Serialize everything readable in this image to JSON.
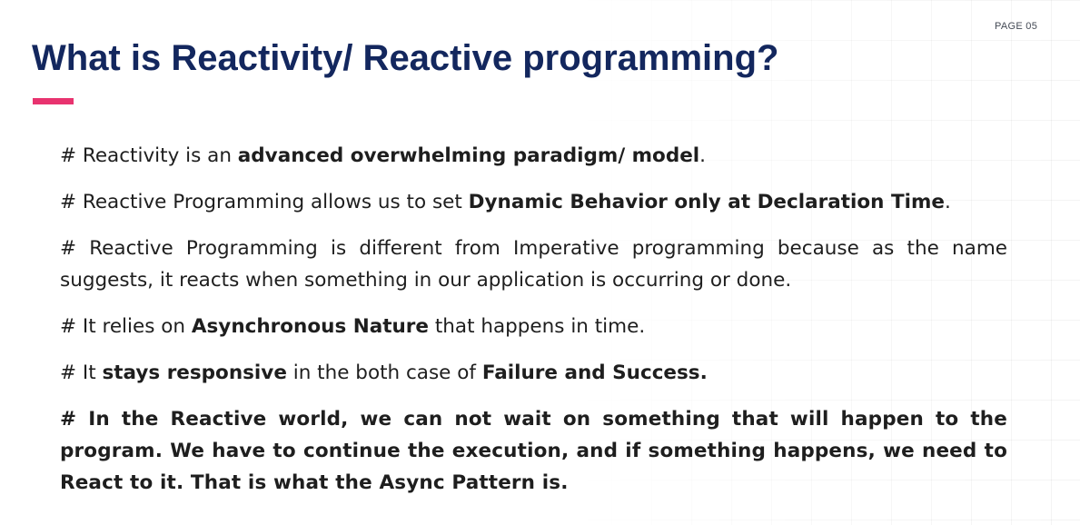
{
  "page_label": "PAGE 05",
  "title": "What is Reactivity/ Reactive programming?",
  "accent_color": "#e8336f",
  "title_color": "#13275e",
  "points": [
    {
      "prefix": "# Reactivity is an ",
      "bold": "advanced overwhelming paradigm/ model",
      "suffix": "."
    },
    {
      "prefix": "# Reactive Programming allows us to set ",
      "bold": "Dynamic Behavior only at Declaration Time",
      "suffix": "."
    },
    {
      "text": "# Reactive Programming is different from Imperative programming because as the name suggests, it reacts when something in our application is occurring or done."
    },
    {
      "prefix": "# It relies on ",
      "bold": "Asynchronous Nature",
      "suffix": " that happens in time."
    },
    {
      "prefix": "# It ",
      "bold": "stays responsive",
      "middle": " in the both case of ",
      "bold2": "Failure and Success."
    },
    {
      "text": "# In the Reactive world, we can not wait on something that will happen to the program. We have to continue the execution, and if something happens, we need to React to it. That is what the Async Pattern is."
    }
  ]
}
